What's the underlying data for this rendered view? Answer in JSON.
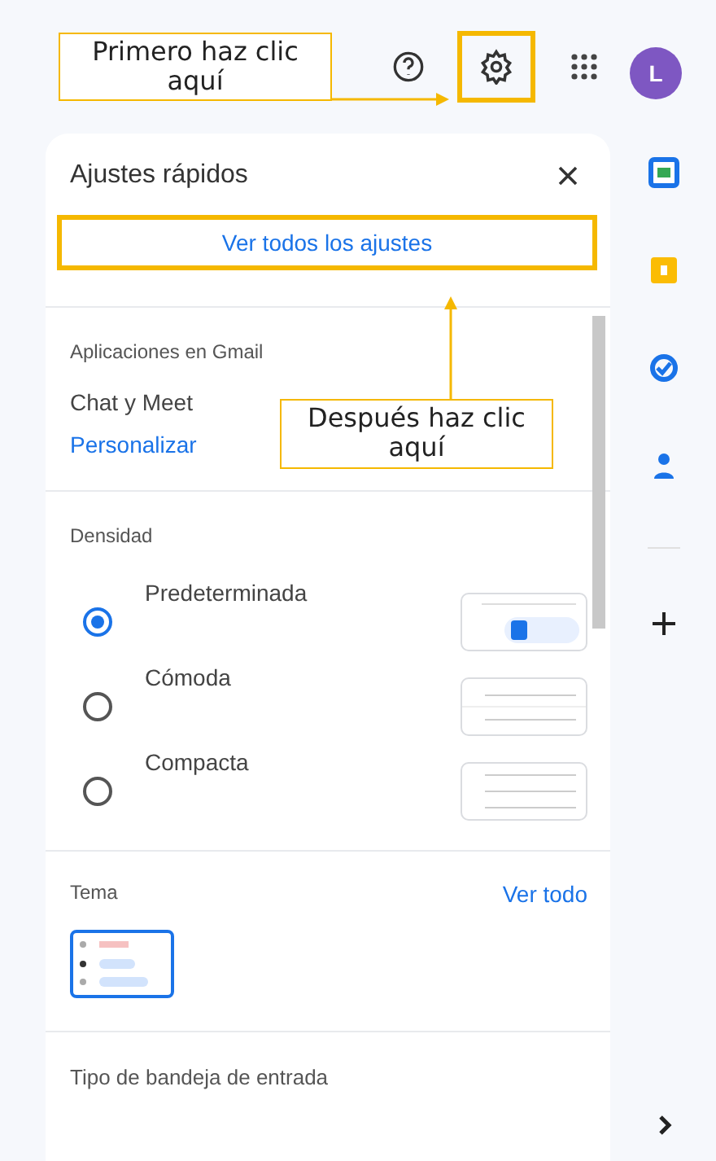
{
  "top_bar": {
    "avatar_letter": "L"
  },
  "quick_settings": {
    "title": "Ajustes rápidos",
    "all_settings_button": "Ver todos los ajustes",
    "apps_section": {
      "heading": "Aplicaciones en Gmail",
      "label": "Chat y Meet",
      "link": "Personalizar"
    },
    "density_section": {
      "heading": "Densidad",
      "options": [
        {
          "label": "Predeterminada",
          "selected": true,
          "kind": "default"
        },
        {
          "label": "Cómoda",
          "selected": false,
          "kind": "comfortable"
        },
        {
          "label": "Compacta",
          "selected": false,
          "kind": "compact"
        }
      ]
    },
    "theme_section": {
      "heading": "Tema",
      "link": "Ver todo"
    },
    "inbox_section": {
      "heading": "Tipo de bandeja de entrada"
    }
  },
  "callouts": {
    "gear": "Primero haz clic aquí",
    "all_settings": "Después haz clic aquí"
  }
}
